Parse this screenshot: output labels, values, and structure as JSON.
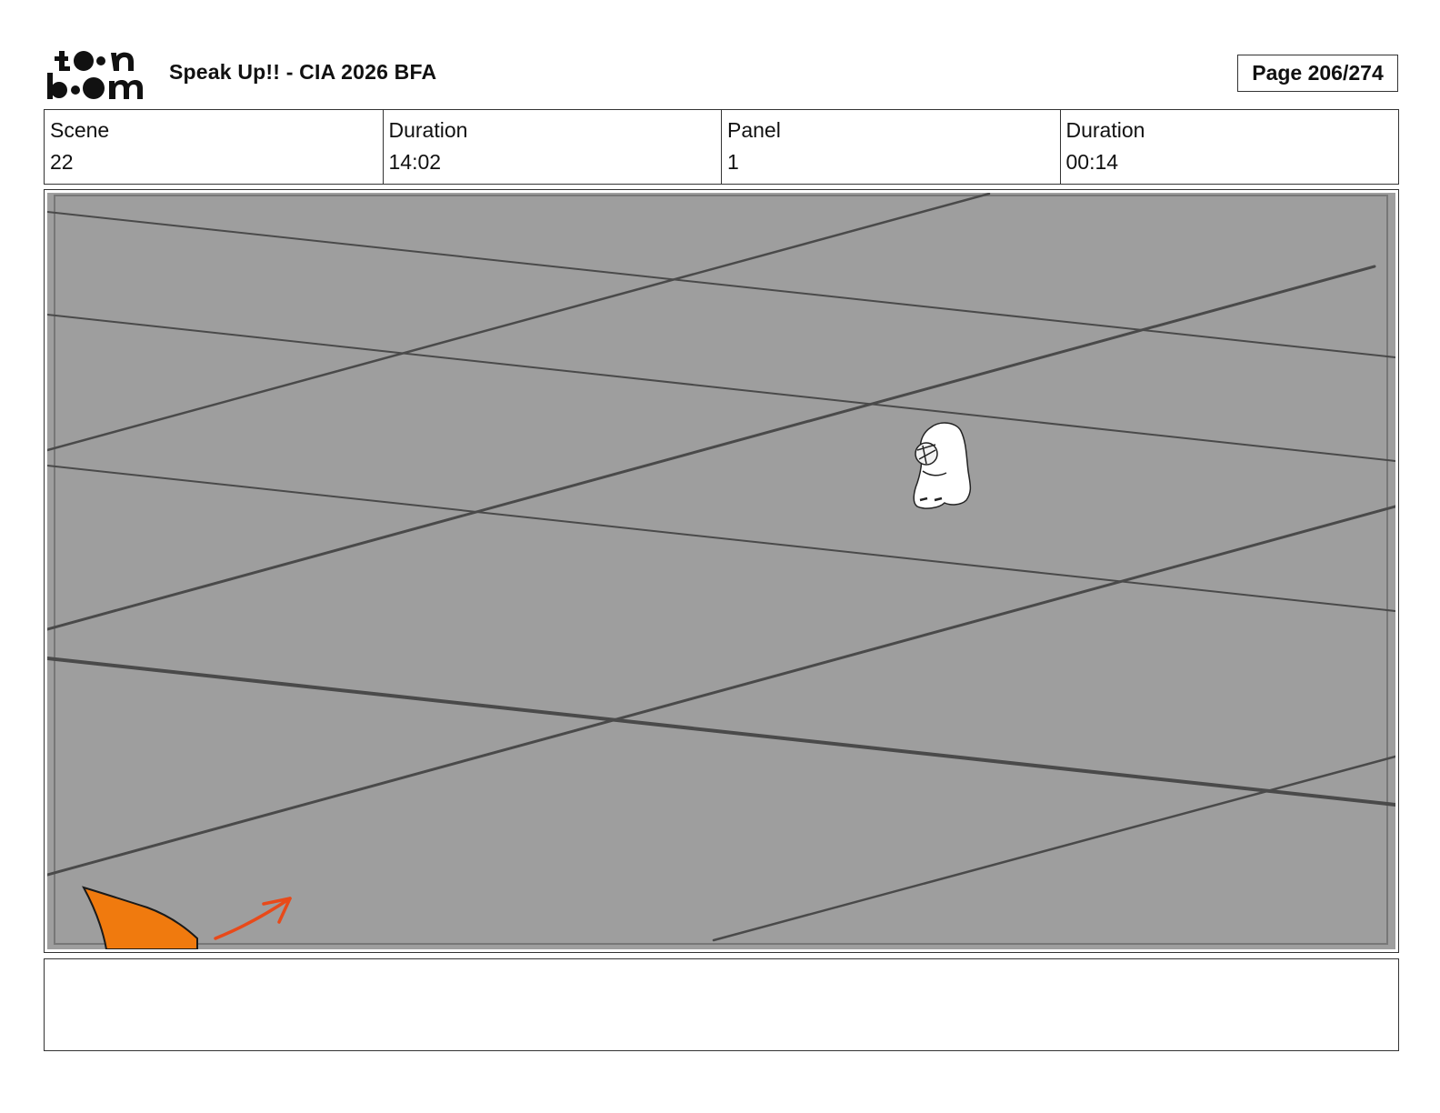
{
  "header": {
    "logo_text": "toon boom",
    "project_title": "Speak Up!! - CIA 2026 BFA",
    "page_label": "Page 206/274"
  },
  "info": {
    "scene_label": "Scene",
    "scene_value": "22",
    "scene_duration_label": "Duration",
    "scene_duration_value": "14:02",
    "panel_label": "Panel",
    "panel_value": "1",
    "panel_duration_label": "Duration",
    "panel_duration_value": "00:14"
  },
  "panel": {
    "background_color": "#9e9e9e",
    "line_color": "#4a4a4a",
    "shape_color": "#f07a0e",
    "arrow_color": "#e84a1a",
    "figure_color": "#ffffff"
  },
  "notes": {
    "text": ""
  }
}
